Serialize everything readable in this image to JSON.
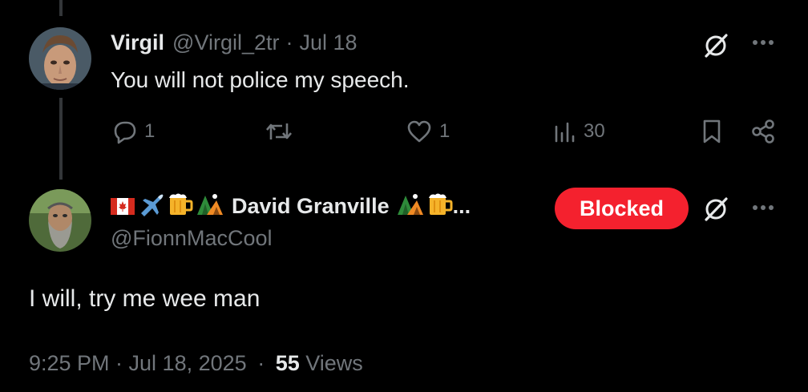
{
  "parent_tweet": {
    "author_name": "Virgil",
    "handle": "@Virgil_2tr",
    "separator": "·",
    "date": "Jul 18",
    "text": "You will not police my speech.",
    "replies": "1",
    "likes": "1",
    "views": "30",
    "icons": [
      "grok-icon",
      "more-icon",
      "reply-icon",
      "retweet-icon",
      "like-icon",
      "views-icon",
      "bookmark-icon",
      "share-icon"
    ]
  },
  "main_tweet": {
    "author_name": "David Granville",
    "name_emoji_prefix": [
      "canada-flag",
      "airplane",
      "beer-mug",
      "camping-tent"
    ],
    "name_emoji_suffix": [
      "camping-tent",
      "beer-mug"
    ],
    "name_ellipsis": "...",
    "handle": "@FionnMacCool",
    "blocked_label": "Blocked",
    "text": "I will, try me wee man",
    "timestamp": "9:25 PM · Jul 18, 2025",
    "meta_separator": "·",
    "views_count": "55",
    "views_label": "Views"
  },
  "colors": {
    "background": "#000000",
    "text_primary": "#e7e9ea",
    "text_muted": "#71767b",
    "blocked_red": "#f4212e"
  }
}
